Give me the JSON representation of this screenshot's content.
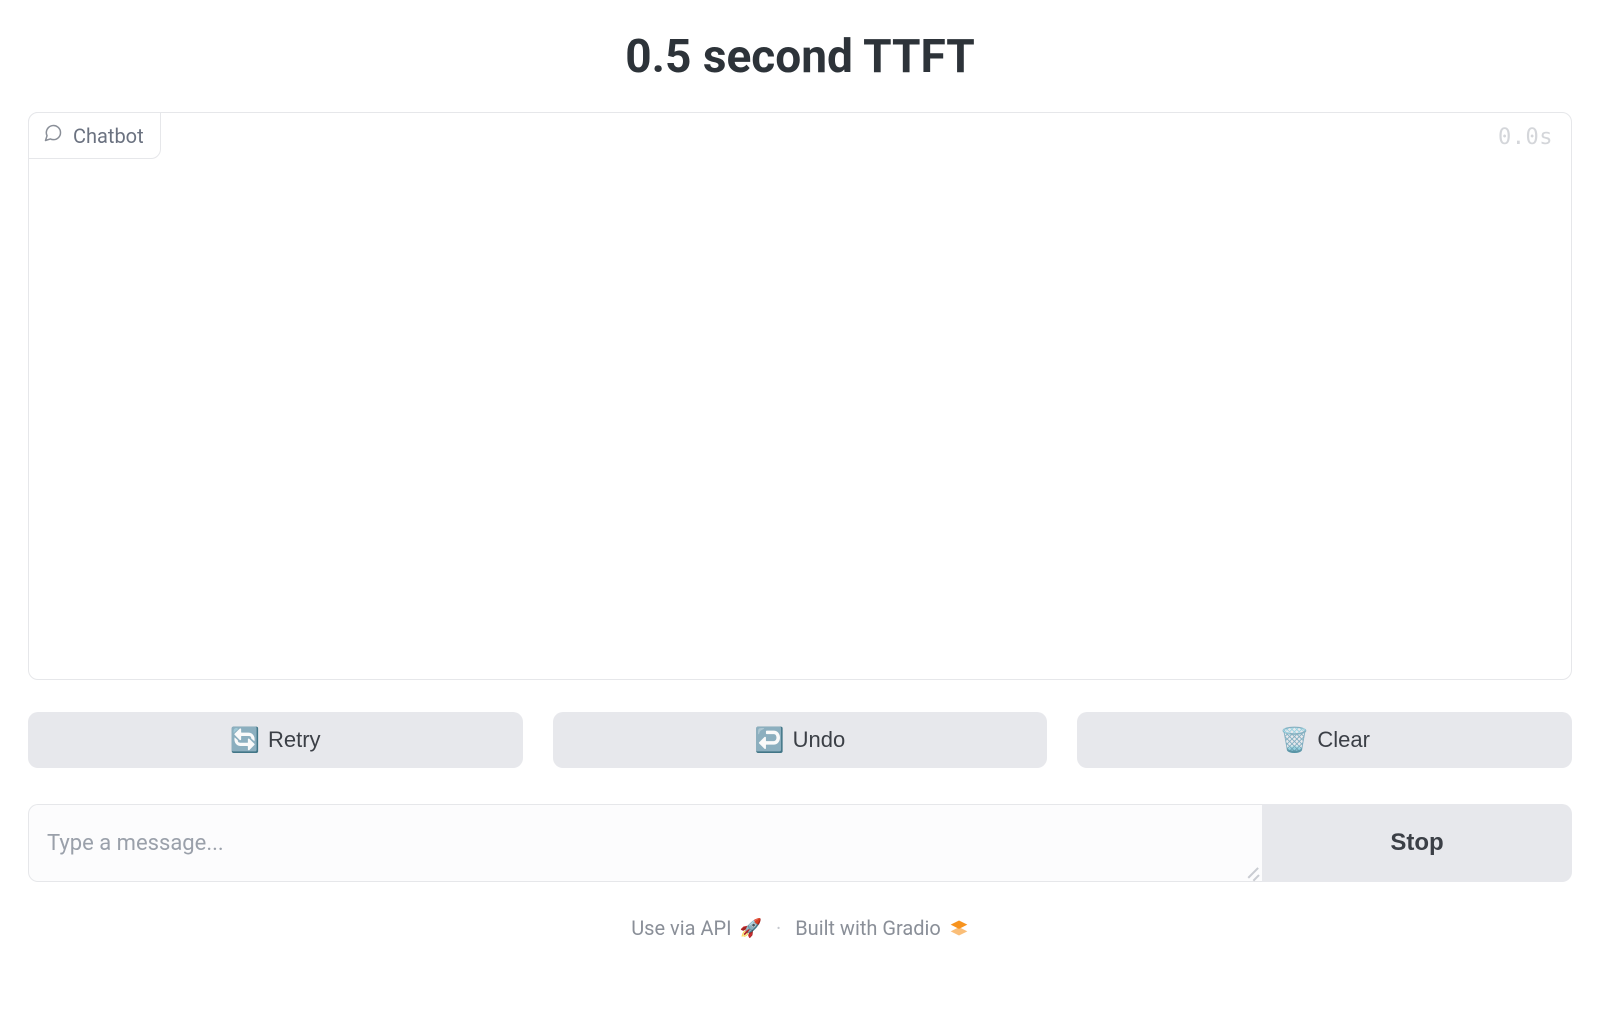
{
  "title": "0.5 second TTFT",
  "chatbox": {
    "tab_label": "Chatbot",
    "timer": "0.0s"
  },
  "actions": {
    "retry_icon": "🔄",
    "retry_label": "Retry",
    "undo_icon": "↩️",
    "undo_label": "Undo",
    "clear_icon": "🗑️",
    "clear_label": "Clear"
  },
  "input": {
    "placeholder": "Type a message...",
    "value": "",
    "stop_label": "Stop"
  },
  "footer": {
    "api_label": "Use via API",
    "rocket_icon": "🚀",
    "separator": "·",
    "built_label": "Built with Gradio"
  }
}
